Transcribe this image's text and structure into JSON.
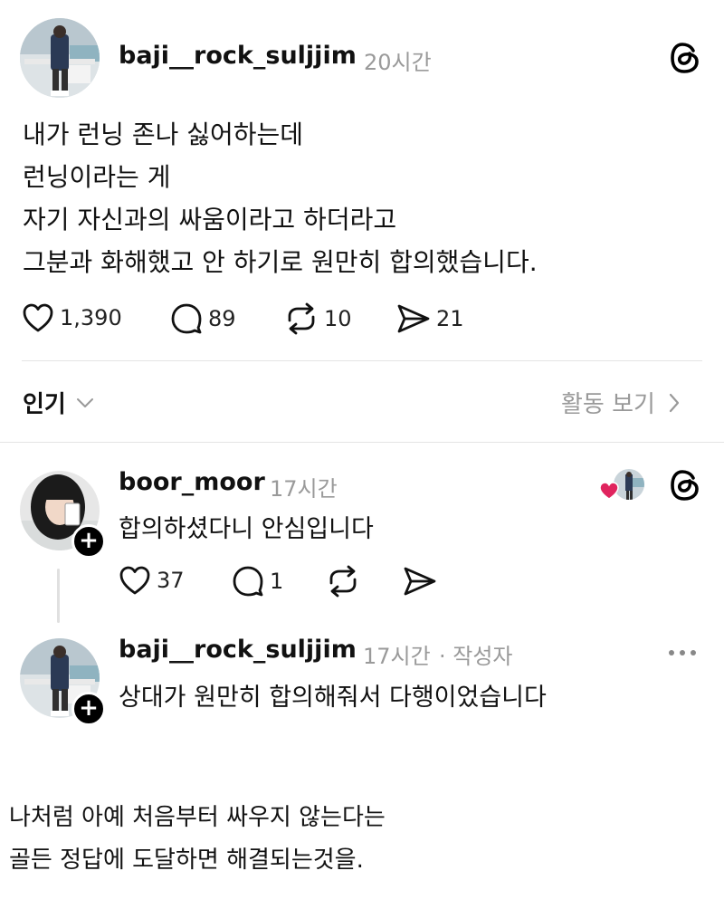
{
  "original_post": {
    "username": "baji__rock_suljjim",
    "timestamp": "20시간",
    "lines": [
      "내가 런닝 존나 싫어하는데",
      "런닝이라는 게",
      "자기 자신과의 싸움이라고 하더라고",
      "그분과 화해했고 안 하기로 원만히 합의했습니다."
    ],
    "likes": "1,390",
    "comments": "89",
    "reposts": "10",
    "shares": "21"
  },
  "sort_bar": {
    "sort_label": "인기",
    "activity_label": "활동 보기"
  },
  "reply_1": {
    "username": "boor_moor",
    "timestamp": "17시간",
    "text": "합의하셨다니 안심입니다",
    "likes": "37",
    "comments": "1"
  },
  "reply_2": {
    "username": "baji__rock_suljjim",
    "timestamp": "17시간",
    "author_tag": "· 작성자",
    "text": "상대가 원만히 합의해줘서 다행이었습니다"
  },
  "caption": {
    "lines": [
      "나처럼 아예 처음부터 싸우지 않는다는",
      "골든 정답에 도달하면 해결되는것을."
    ]
  },
  "colors": {
    "text": "#111111",
    "muted": "#9a9a9a",
    "divider": "#e4e4e4",
    "heart": "#e0245e"
  },
  "icons": [
    "threads-logo-icon",
    "heart-icon",
    "comment-icon",
    "repost-icon",
    "share-icon",
    "chevron-down-icon",
    "chevron-right-icon",
    "more-icon",
    "plus-icon"
  ]
}
